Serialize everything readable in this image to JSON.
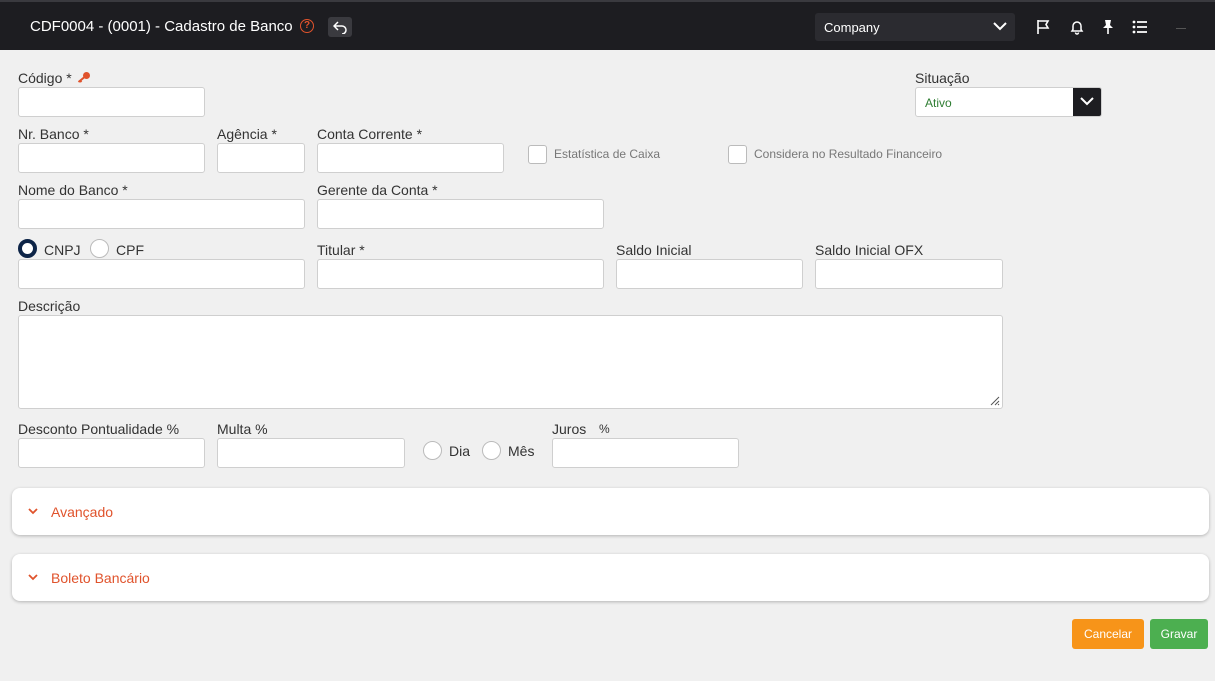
{
  "header": {
    "title": "CDF0004 - (0001) - Cadastro de Banco",
    "help_glyph": "?",
    "company_select": "Company",
    "icons": [
      "help-icon",
      "back-arrow-icon",
      "flag-icon",
      "bell-icon",
      "pin-icon",
      "list-icon"
    ]
  },
  "form": {
    "codigo_label": "Código *",
    "situacao_label": "Situação",
    "situacao_value": "Ativo",
    "nr_banco_label": "Nr. Banco *",
    "agencia_label": "Agência *",
    "conta_corrente_label": "Conta Corrente *",
    "estatistica_label": "Estatística de Caixa",
    "considera_label": "Considera no Resultado Financeiro",
    "nome_banco_label": "Nome do Banco *",
    "gerente_label": "Gerente da Conta *",
    "cnpj_label": "CNPJ",
    "cpf_label": "CPF",
    "titular_label": "Titular *",
    "saldo_inicial_label": "Saldo Inicial",
    "saldo_ofx_label": "Saldo Inicial OFX",
    "descricao_label": "Descrição",
    "desconto_label": "Desconto Pontualidade %",
    "multa_label": "Multa %",
    "dia_label": "Dia",
    "mes_label": "Mês",
    "juros_label": "Juros",
    "juros_unit": "%",
    "selected_doc_type": "CNPJ"
  },
  "panels": {
    "avancado": "Avançado",
    "boleto": "Boleto Bancário"
  },
  "actions": {
    "cancel": "Cancelar",
    "save": "Gravar"
  },
  "colors": {
    "accent": "#e0532c",
    "header_bg": "#1d1d21",
    "cancel": "#f79419",
    "save": "#4caf50",
    "status_active": "#2e7d32"
  }
}
